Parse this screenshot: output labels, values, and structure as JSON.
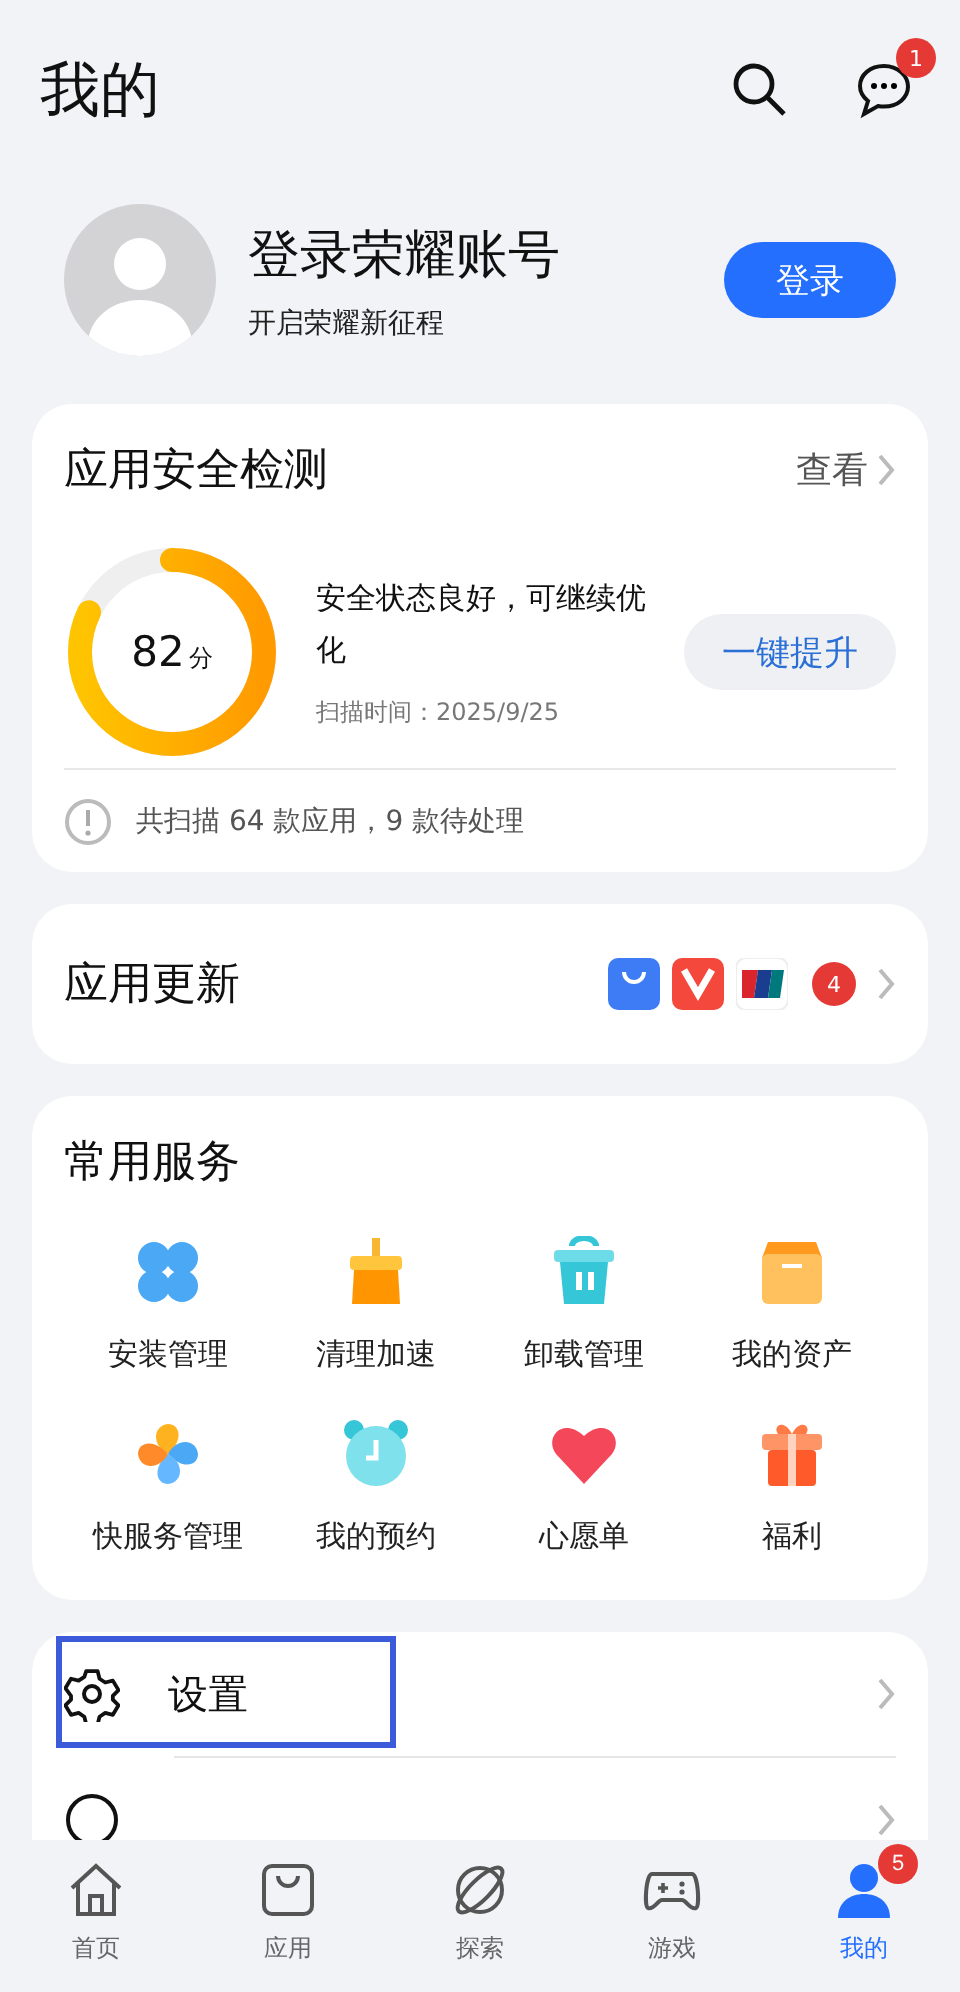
{
  "header": {
    "title": "我的",
    "message_badge": "1"
  },
  "profile": {
    "name": "登录荣耀账号",
    "subtitle": "开启荣耀新征程",
    "login_button": "登录"
  },
  "security": {
    "title": "应用安全检测",
    "view_link": "查看",
    "score": "82",
    "score_unit": "分",
    "level": 0.82,
    "status": "安全状态良好，可继续优化",
    "scan_time": "扫描时间：2025/9/25",
    "boost_button": "一键提升",
    "summary": "共扫描 64 款应用，9 款待处理"
  },
  "updates": {
    "title": "应用更新",
    "count": "4"
  },
  "services": {
    "title": "常用服务",
    "items": [
      {
        "kind": "clover",
        "label": "安装管理"
      },
      {
        "kind": "broom",
        "label": "清理加速"
      },
      {
        "kind": "trash",
        "label": "卸载管理"
      },
      {
        "kind": "box",
        "label": "我的资产"
      },
      {
        "kind": "pinwheel",
        "label": "快服务管理"
      },
      {
        "kind": "clock",
        "label": "我的预约"
      },
      {
        "kind": "heart",
        "label": "心愿单"
      },
      {
        "kind": "gift",
        "label": "福利"
      }
    ]
  },
  "menu": [
    {
      "kind": "settings",
      "label": "设置",
      "highlighted": true
    },
    {
      "kind": "help",
      "highlighted": false
    }
  ],
  "tabs": [
    {
      "kind": "home",
      "label": "首页",
      "selected": false
    },
    {
      "kind": "apps",
      "label": "应用",
      "selected": false
    },
    {
      "kind": "explore",
      "label": "探索",
      "selected": false
    },
    {
      "kind": "games",
      "label": "游戏",
      "selected": false
    },
    {
      "kind": "me",
      "label": "我的",
      "selected": true,
      "badge": "5"
    }
  ]
}
